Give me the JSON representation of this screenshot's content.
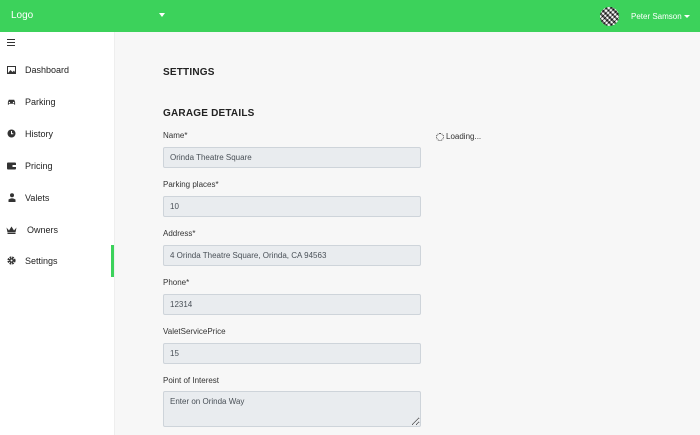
{
  "topbar": {
    "logo": "Logo",
    "user_name": "Peter Samson",
    "accent_color": "#3cd25b"
  },
  "sidebar": {
    "items": [
      {
        "label": "Dashboard",
        "icon": "image-icon"
      },
      {
        "label": "Parking",
        "icon": "car-icon"
      },
      {
        "label": "History",
        "icon": "clock-icon"
      },
      {
        "label": "Pricing",
        "icon": "wallet-icon"
      },
      {
        "label": "Valets",
        "icon": "user-icon"
      },
      {
        "label": "Owners",
        "icon": "crown-icon"
      },
      {
        "label": "Settings",
        "icon": "gear-icon",
        "active": true
      }
    ]
  },
  "main": {
    "title": "SETTINGS",
    "section_title": "GARAGE DETAILS",
    "loading": "Loading...",
    "fields": [
      {
        "label": "Name*",
        "value": "Orinda Theatre Square"
      },
      {
        "label": "Parking places*",
        "value": "10"
      },
      {
        "label": "Address*",
        "value": "4 Orinda Theatre Square, Orinda, CA 94563"
      },
      {
        "label": "Phone*",
        "value": "12314"
      },
      {
        "label": "ValetServicePrice",
        "value": "15"
      },
      {
        "label": "Point of Interest",
        "value": "Enter on Orinda Way"
      }
    ]
  }
}
